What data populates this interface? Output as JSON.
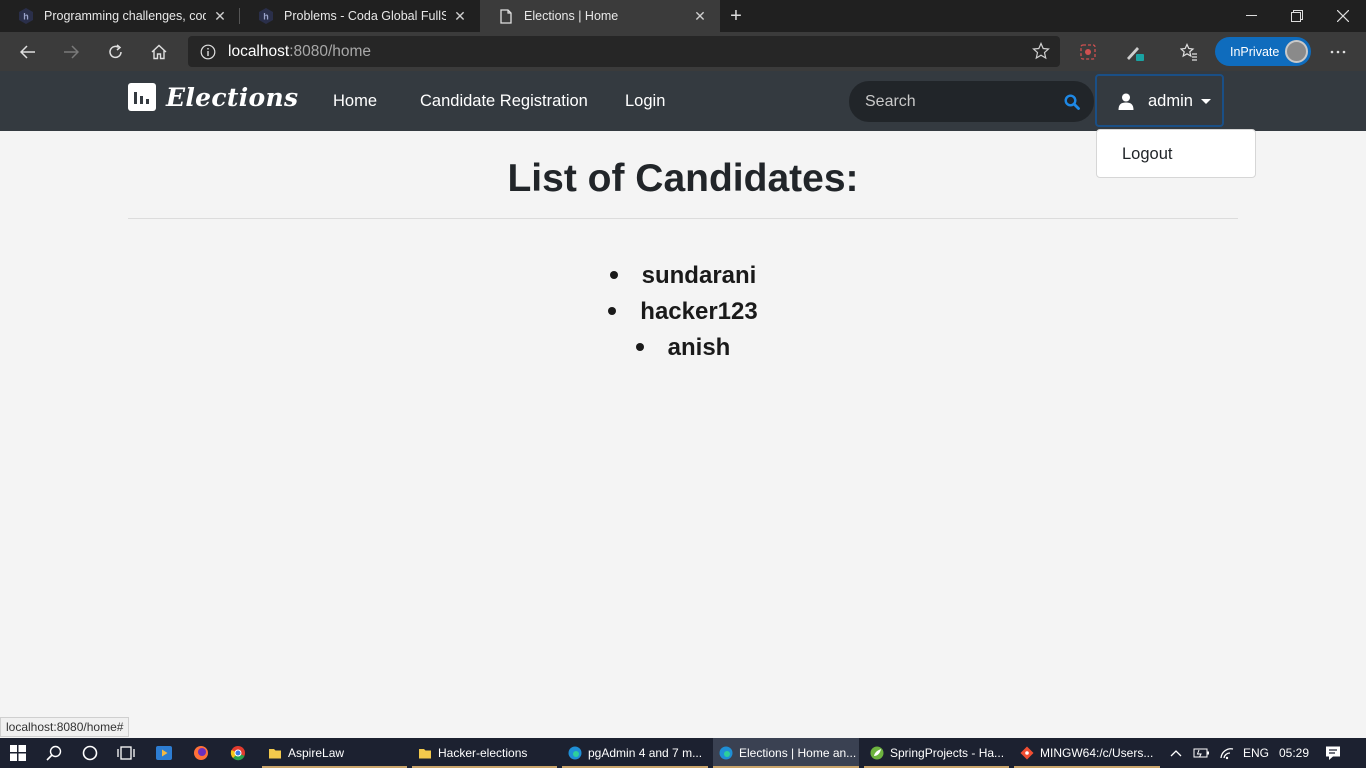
{
  "browser": {
    "tabs": [
      {
        "title": "Programming challenges, coding"
      },
      {
        "title": "Problems - Coda Global FullStack"
      },
      {
        "title": "Elections | Home"
      }
    ],
    "url_host": "localhost",
    "url_rest": ":8080/home",
    "inprivate_label": "InPrivate",
    "status_url": "localhost:8080/home#"
  },
  "navbar": {
    "brand": "Elections",
    "links": [
      "Home",
      "Candidate Registration",
      "Login"
    ],
    "search_placeholder": "Search",
    "user": "admin",
    "dropdown": [
      "Logout"
    ]
  },
  "main": {
    "heading": "List of Candidates:",
    "candidates": [
      "sundarani",
      "hacker123",
      "anish"
    ]
  },
  "taskbar": {
    "apps": [
      {
        "label": "AspireLaw"
      },
      {
        "label": "Hacker-elections"
      },
      {
        "label": "pgAdmin 4 and 7 m..."
      },
      {
        "label": "Elections | Home an..."
      },
      {
        "label": "SpringProjects - Ha..."
      },
      {
        "label": "MINGW64:/c/Users..."
      }
    ],
    "language": "ENG",
    "time": "05:29"
  }
}
